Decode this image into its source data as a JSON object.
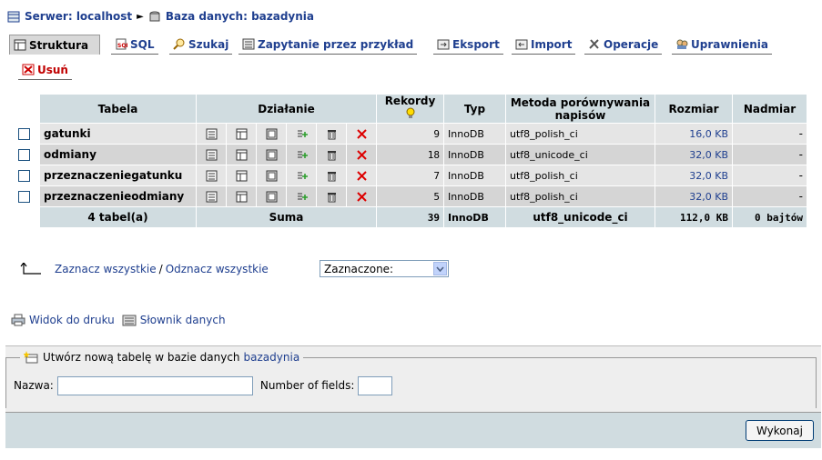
{
  "breadcrumb": {
    "server_label": "Serwer: localhost",
    "database_label": "Baza danych: bazadynia",
    "separator": "►"
  },
  "tabs": [
    {
      "label": "Struktura",
      "icon": "structure-icon",
      "active": true
    },
    {
      "label": "SQL",
      "icon": "sql-icon"
    },
    {
      "label": "Szukaj",
      "icon": "search-icon"
    },
    {
      "label": "Zapytanie przez przykład",
      "icon": "query-icon"
    },
    {
      "label": "Eksport",
      "icon": "export-icon"
    },
    {
      "label": "Import",
      "icon": "import-icon"
    },
    {
      "label": "Operacje",
      "icon": "operations-icon"
    },
    {
      "label": "Uprawnienia",
      "icon": "privileges-icon"
    },
    {
      "label": "Usuń",
      "icon": "drop-icon",
      "danger": true
    }
  ],
  "table": {
    "headers": {
      "table": "Tabela",
      "action": "Działanie",
      "records": "Rekordy",
      "type": "Typ",
      "collation": "Metoda porównywania napisów",
      "size": "Rozmiar",
      "overhead": "Nadmiar"
    },
    "rows": [
      {
        "name": "gatunki",
        "records": "9",
        "type": "InnoDB",
        "collation": "utf8_polish_ci",
        "size": "16,0 KB",
        "overhead": "-"
      },
      {
        "name": "odmiany",
        "records": "18",
        "type": "InnoDB",
        "collation": "utf8_unicode_ci",
        "size": "32,0 KB",
        "overhead": "-"
      },
      {
        "name": "przeznaczeniegatunku",
        "records": "7",
        "type": "InnoDB",
        "collation": "utf8_polish_ci",
        "size": "32,0 KB",
        "overhead": "-"
      },
      {
        "name": "przeznaczenieodmiany",
        "records": "5",
        "type": "InnoDB",
        "collation": "utf8_polish_ci",
        "size": "32,0 KB",
        "overhead": "-"
      }
    ],
    "summary": {
      "tables": "4 tabel(a)",
      "label": "Suma",
      "records": "39",
      "type": "InnoDB",
      "collation": "utf8_unicode_ci",
      "size": "112,0 KB",
      "overhead": "0 bajtów"
    }
  },
  "selection": {
    "select_all": "Zaznacz wszystkie",
    "divider": "/",
    "deselect_all": "Odznacz wszystkie",
    "with_selected": "Zaznaczone:"
  },
  "links": {
    "print_view": "Widok do druku",
    "data_dictionary": "Słownik danych"
  },
  "create_table": {
    "legend": "Utwórz nową tabelę w bazie danych",
    "database": "bazadynia",
    "name_label": "Nazwa:",
    "name_value": "",
    "fields_label": "Number of fields:",
    "fields_value": "",
    "submit": "Wykonaj"
  }
}
